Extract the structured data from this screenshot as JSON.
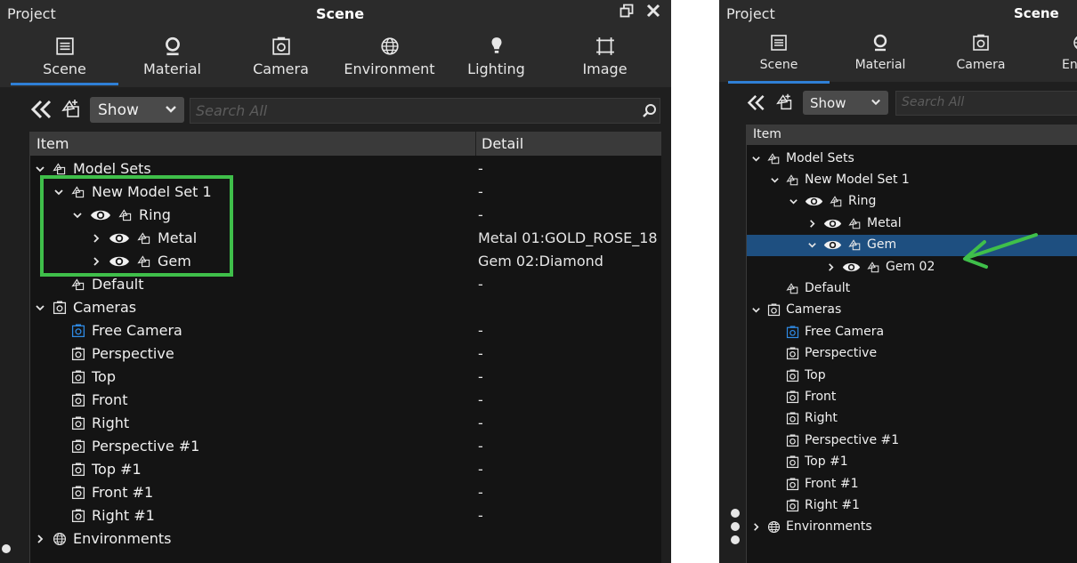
{
  "colors": {
    "accent": "#2f7fd6",
    "highlight_box": "#3fbf4a",
    "selection": "#1e4f80",
    "camera_active": "#2f8be6"
  },
  "left_panel": {
    "title_left": "Project",
    "title_center": "Scene",
    "tabs": [
      {
        "label": "Scene",
        "icon": "scene-list-icon"
      },
      {
        "label": "Material",
        "icon": "material-icon"
      },
      {
        "label": "Camera",
        "icon": "camera-icon"
      },
      {
        "label": "Environment",
        "icon": "globe-icon"
      },
      {
        "label": "Lighting",
        "icon": "lightbulb-icon"
      },
      {
        "label": "Image",
        "icon": "image-frame-icon"
      }
    ],
    "toolbar": {
      "show_label": "Show",
      "search_placeholder": "Search All"
    },
    "table": {
      "col_item": "Item",
      "col_detail": "Detail"
    },
    "rows": [
      {
        "label": "Model Sets",
        "detail": "-",
        "chevron": "down",
        "eye": false,
        "icon": "model-set-icon"
      },
      {
        "label": "New Model Set 1",
        "detail": "-",
        "chevron": "down",
        "eye": false,
        "icon": "model-set-icon"
      },
      {
        "label": "Ring",
        "detail": "-",
        "chevron": "down",
        "eye": true,
        "icon": "model-set-icon"
      },
      {
        "label": "Metal",
        "detail": "Metal 01:GOLD_ROSE_18",
        "chevron": "right",
        "eye": true,
        "icon": "model-set-icon"
      },
      {
        "label": "Gem",
        "detail": "Gem 02:Diamond",
        "chevron": "right",
        "eye": true,
        "icon": "model-set-icon"
      },
      {
        "label": "Default",
        "detail": "-",
        "chevron": "",
        "eye": false,
        "icon": "model-set-icon"
      },
      {
        "label": "Cameras",
        "detail": "",
        "chevron": "down",
        "eye": false,
        "icon": "camera-icon"
      },
      {
        "label": "Free Camera",
        "detail": "-",
        "chevron": "",
        "eye": false,
        "icon": "camera-icon",
        "active": true
      },
      {
        "label": "Perspective",
        "detail": "-",
        "chevron": "",
        "eye": false,
        "icon": "camera-icon"
      },
      {
        "label": "Top",
        "detail": "-",
        "chevron": "",
        "eye": false,
        "icon": "camera-icon"
      },
      {
        "label": "Front",
        "detail": "-",
        "chevron": "",
        "eye": false,
        "icon": "camera-icon"
      },
      {
        "label": "Right",
        "detail": "-",
        "chevron": "",
        "eye": false,
        "icon": "camera-icon"
      },
      {
        "label": "Perspective #1",
        "detail": "-",
        "chevron": "",
        "eye": false,
        "icon": "camera-icon"
      },
      {
        "label": "Top #1",
        "detail": "-",
        "chevron": "",
        "eye": false,
        "icon": "camera-icon"
      },
      {
        "label": "Front #1",
        "detail": "-",
        "chevron": "",
        "eye": false,
        "icon": "camera-icon"
      },
      {
        "label": "Right #1",
        "detail": "-",
        "chevron": "",
        "eye": false,
        "icon": "camera-icon"
      },
      {
        "label": "Environments",
        "detail": "",
        "chevron": "right",
        "eye": false,
        "icon": "globe-icon"
      }
    ]
  },
  "right_panel": {
    "title_left": "Project",
    "title_center": "Scene",
    "tabs": [
      {
        "label": "Scene",
        "icon": "scene-list-icon"
      },
      {
        "label": "Material",
        "icon": "material-icon"
      },
      {
        "label": "Camera",
        "icon": "camera-icon"
      },
      {
        "label": "Enviro",
        "icon": "globe-icon"
      }
    ],
    "toolbar": {
      "show_label": "Show",
      "search_placeholder": "Search All"
    },
    "table": {
      "col_item": "Item"
    },
    "rows": [
      {
        "label": "Model Sets",
        "chevron": "down",
        "eye": false,
        "icon": "model-set-icon"
      },
      {
        "label": "New Model Set 1",
        "chevron": "down",
        "eye": false,
        "icon": "model-set-icon"
      },
      {
        "label": "Ring",
        "chevron": "down",
        "eye": true,
        "icon": "model-set-icon"
      },
      {
        "label": "Metal",
        "chevron": "right",
        "eye": true,
        "icon": "model-set-icon"
      },
      {
        "label": "Gem",
        "chevron": "down",
        "eye": true,
        "icon": "model-set-icon",
        "selected": true
      },
      {
        "label": "Gem 02",
        "chevron": "right",
        "eye": true,
        "icon": "model-set-icon"
      },
      {
        "label": "Default",
        "chevron": "",
        "eye": false,
        "icon": "model-set-icon"
      },
      {
        "label": "Cameras",
        "chevron": "down",
        "eye": false,
        "icon": "camera-icon"
      },
      {
        "label": "Free Camera",
        "chevron": "",
        "eye": false,
        "icon": "camera-icon",
        "active": true
      },
      {
        "label": "Perspective",
        "chevron": "",
        "eye": false,
        "icon": "camera-icon"
      },
      {
        "label": "Top",
        "chevron": "",
        "eye": false,
        "icon": "camera-icon"
      },
      {
        "label": "Front",
        "chevron": "",
        "eye": false,
        "icon": "camera-icon"
      },
      {
        "label": "Right",
        "chevron": "",
        "eye": false,
        "icon": "camera-icon"
      },
      {
        "label": "Perspective #1",
        "chevron": "",
        "eye": false,
        "icon": "camera-icon"
      },
      {
        "label": "Top #1",
        "chevron": "",
        "eye": false,
        "icon": "camera-icon"
      },
      {
        "label": "Front #1",
        "chevron": "",
        "eye": false,
        "icon": "camera-icon"
      },
      {
        "label": "Right #1",
        "chevron": "",
        "eye": false,
        "icon": "camera-icon"
      },
      {
        "label": "Environments",
        "chevron": "right",
        "eye": false,
        "icon": "globe-icon"
      }
    ]
  }
}
